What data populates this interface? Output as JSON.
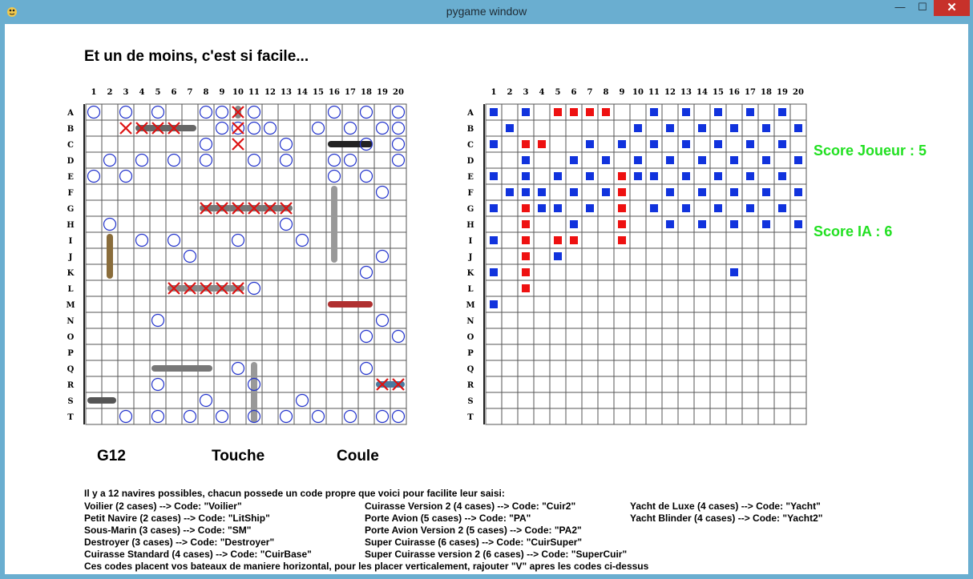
{
  "window": {
    "title": "pygame window",
    "minimize": "—",
    "maximize": "☐",
    "close": "✕"
  },
  "message": "Et un de moins, c'est si facile...",
  "columns": [
    "1",
    "2",
    "3",
    "4",
    "5",
    "6",
    "7",
    "8",
    "9",
    "10",
    "11",
    "12",
    "13",
    "14",
    "15",
    "16",
    "17",
    "18",
    "19",
    "20"
  ],
  "rows": [
    "A",
    "B",
    "C",
    "D",
    "E",
    "F",
    "G",
    "H",
    "I",
    "J",
    "K",
    "L",
    "M",
    "N",
    "O",
    "P",
    "Q",
    "R",
    "S",
    "T"
  ],
  "colors": {
    "grid": "#555555",
    "miss_circle": "#2233cc",
    "hit_cross": "#dd1111",
    "ai_miss": "#1133dd",
    "ai_hit": "#ee1111",
    "score": "#22e022"
  },
  "player_board": {
    "misses": [
      "A1",
      "A3",
      "A5",
      "A8",
      "A9",
      "A11",
      "A16",
      "A18",
      "A20",
      "B9",
      "B10",
      "B11",
      "B12",
      "B15",
      "B17",
      "B19",
      "B20",
      "C8",
      "C13",
      "C18",
      "C20",
      "D2",
      "D4",
      "D6",
      "D8",
      "D11",
      "D13",
      "D16",
      "D17",
      "D20",
      "E1",
      "E3",
      "E16",
      "E18",
      "F19",
      "H2",
      "H13",
      "I4",
      "I6",
      "I10",
      "I14",
      "J7",
      "J19",
      "K18",
      "L11",
      "N5",
      "N19",
      "O18",
      "O20",
      "Q10",
      "Q18",
      "R5",
      "R11",
      "S8",
      "S14",
      "T3",
      "T5",
      "T7",
      "T9",
      "T11",
      "T13",
      "T15",
      "T17",
      "T19",
      "T20"
    ],
    "hits": [
      "A10",
      "B3",
      "B4",
      "B5",
      "B6",
      "B10",
      "C10",
      "G8",
      "G9",
      "G10",
      "G11",
      "G12",
      "G13",
      "L6",
      "L7",
      "L8",
      "L9",
      "L10",
      "R19",
      "R20"
    ],
    "ships": [
      {
        "name": "ship-b-icon",
        "row": "B",
        "col": 4,
        "len": 4,
        "orient": "h",
        "color": "#666"
      },
      {
        "name": "ship-a-icon",
        "row": "A",
        "col": 10,
        "len": 1,
        "orient": "v",
        "color": "#888"
      },
      {
        "name": "ship-c-icon",
        "row": "C",
        "col": 16,
        "len": 3,
        "orient": "h",
        "color": "#222"
      },
      {
        "name": "ship-g-icon",
        "row": "G",
        "col": 8,
        "len": 6,
        "orient": "h",
        "color": "#777"
      },
      {
        "name": "carrier-icon",
        "row": "F",
        "col": 16,
        "len": 5,
        "orient": "v",
        "color": "#999"
      },
      {
        "name": "sailboat-icon",
        "row": "I",
        "col": 2,
        "len": 3,
        "orient": "v",
        "color": "#8a6d3b"
      },
      {
        "name": "ship-l-icon",
        "row": "L",
        "col": 6,
        "len": 5,
        "orient": "h",
        "color": "#888"
      },
      {
        "name": "yacht-icon",
        "row": "M",
        "col": 16,
        "len": 3,
        "orient": "h",
        "color": "#b03030"
      },
      {
        "name": "battleship-icon",
        "row": "Q",
        "col": 5,
        "len": 4,
        "orient": "h",
        "color": "#777"
      },
      {
        "name": "luxury-yacht-icon",
        "row": "Q",
        "col": 11,
        "len": 4,
        "orient": "v",
        "color": "#999"
      },
      {
        "name": "small-boat-icon",
        "row": "S",
        "col": 1,
        "len": 2,
        "orient": "h",
        "color": "#555"
      },
      {
        "name": "ship-r-icon",
        "row": "R",
        "col": 19,
        "len": 2,
        "orient": "h",
        "color": "#4a7aa0"
      }
    ]
  },
  "ai_board": {
    "misses": [
      "A1",
      "A3",
      "A11",
      "A13",
      "A15",
      "A17",
      "A19",
      "B2",
      "B10",
      "B12",
      "B14",
      "B16",
      "B18",
      "B20",
      "C1",
      "C7",
      "C9",
      "C11",
      "C13",
      "C15",
      "C17",
      "C19",
      "D3",
      "D6",
      "D8",
      "D10",
      "D12",
      "D14",
      "D16",
      "D18",
      "D20",
      "E1",
      "E3",
      "E5",
      "E7",
      "E10",
      "E11",
      "E13",
      "E15",
      "E17",
      "E19",
      "F2",
      "F3",
      "F4",
      "F6",
      "F8",
      "F12",
      "F14",
      "F16",
      "F18",
      "F20",
      "G1",
      "G4",
      "G5",
      "G7",
      "G11",
      "G13",
      "G15",
      "G17",
      "G19",
      "H6",
      "H12",
      "H14",
      "H16",
      "H18",
      "H20",
      "I1",
      "J5",
      "K1",
      "K16",
      "M1"
    ],
    "hits": [
      "A5",
      "A6",
      "A7",
      "A8",
      "C3",
      "C4",
      "E9",
      "F9",
      "G3",
      "G9",
      "H3",
      "H9",
      "I3",
      "I5",
      "I6",
      "I9",
      "J3",
      "K3",
      "L3"
    ]
  },
  "scores": {
    "player": "Score Joueur :  5",
    "ai": "Score IA : 6"
  },
  "status": {
    "coord": "G12",
    "result": "Touche",
    "sunk": "Coule"
  },
  "info": {
    "intro": "Il y a 12 navires possibles, chacun possede un code propre que voici pour facilite leur saisi:",
    "col1": [
      "Voilier (2 cases) --> Code: \"Voilier\"",
      "Petit Navire (2 cases) --> Code: \"LitShip\"",
      "Sous-Marin (3 cases) --> Code: \"SM\"",
      "Destroyer (3 cases) --> Code: \"Destroyer\"",
      "Cuirasse Standard (4 cases) --> Code: \"CuirBase\""
    ],
    "col2": [
      "Cuirasse Version 2 (4 cases) --> Code: \"Cuir2\"",
      "Porte Avion (5 cases) --> Code: \"PA\"",
      "Porte Avion Version 2 (5 cases) --> Code: \"PA2\"",
      "Super Cuirasse (6 cases) --> Code: \"CuirSuper\"",
      "Super Cuirasse version 2 (6 cases) --> Code: \"SuperCuir\""
    ],
    "col3": [
      "Yacht de Luxe (4 cases) --> Code: \"Yacht\"",
      "Yacht Blinder (4 cases) --> Code: \"Yacht2\""
    ],
    "footer": "Ces codes placent vos bateaux de maniere horizontal, pour les placer verticalement, rajouter \"V\" apres les codes ci-dessus"
  }
}
